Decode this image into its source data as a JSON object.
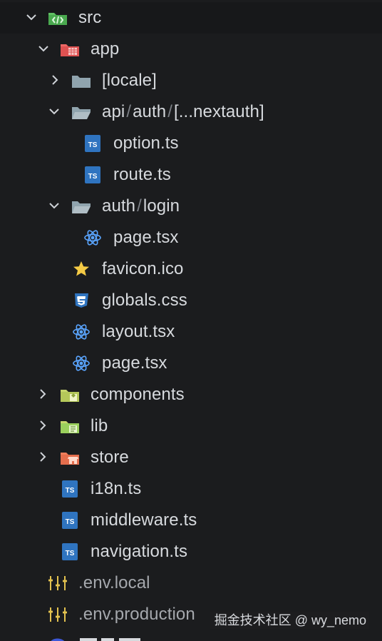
{
  "explorer": {
    "items": [
      {
        "label": "src",
        "icon": "react-source-folder-icon"
      },
      {
        "label": "app",
        "icon": "app-folder-icon"
      },
      {
        "label": "[locale]",
        "icon": "folder-icon"
      },
      {
        "label_parts": [
          "api",
          "auth",
          "[...nextauth]"
        ],
        "icon": "folder-open-icon"
      },
      {
        "label": "option.ts",
        "icon": "typescript-file-icon"
      },
      {
        "label": "route.ts",
        "icon": "typescript-file-icon"
      },
      {
        "label_parts": [
          "auth",
          "login"
        ],
        "icon": "folder-open-icon"
      },
      {
        "label": "page.tsx",
        "icon": "react-tsx-icon"
      },
      {
        "label": "favicon.ico",
        "icon": "favicon-star-icon"
      },
      {
        "label": "globals.css",
        "icon": "css3-file-icon"
      },
      {
        "label": "layout.tsx",
        "icon": "react-tsx-icon"
      },
      {
        "label": "page.tsx",
        "icon": "react-tsx-icon"
      },
      {
        "label": "components",
        "icon": "components-folder-icon"
      },
      {
        "label": "lib",
        "icon": "library-folder-icon"
      },
      {
        "label": "store",
        "icon": "store-folder-icon"
      },
      {
        "label": "i18n.ts",
        "icon": "typescript-file-icon"
      },
      {
        "label": "middleware.ts",
        "icon": "typescript-file-icon"
      },
      {
        "label": "navigation.ts",
        "icon": "typescript-file-icon"
      },
      {
        "label": ".env.local",
        "icon": "env-settings-icon"
      },
      {
        "label": ".env.production",
        "icon": "env-settings-icon"
      }
    ]
  },
  "separators": {
    "slash": "/"
  },
  "watermark": "掘金技术社区 @ wy_nemo",
  "colors": {
    "background": "#1b1c1e",
    "text": "#d7dade",
    "muted_text": "#a5a8ad",
    "typescript_blue": "#2f74c0",
    "react_blue": "#5aa5ff",
    "favicon_yellow": "#f4ca45",
    "src_green": "#5fbf62",
    "app_red": "#ee6866",
    "components_yellow_green": "#c7d66c",
    "lib_green": "#9bd05d",
    "store_orange": "#ef7d5b"
  }
}
